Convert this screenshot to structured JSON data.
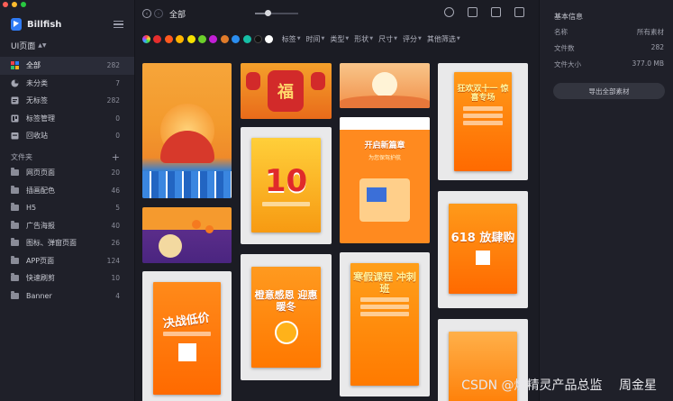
{
  "window": {
    "traffic_colors": [
      "#fe5f57",
      "#febc2e",
      "#28c840"
    ]
  },
  "app": {
    "name": "Billfish"
  },
  "library": {
    "name": "UI页面"
  },
  "nav": [
    {
      "label": "全部",
      "count": "282",
      "icon": "grid-icon",
      "active": true
    },
    {
      "label": "未分类",
      "count": "7",
      "icon": "uncategorized-icon",
      "active": false
    },
    {
      "label": "无标签",
      "count": "282",
      "icon": "untagged-icon",
      "active": false
    },
    {
      "label": "标签管理",
      "count": "0",
      "icon": "tag-manage-icon",
      "active": false
    },
    {
      "label": "回收站",
      "count": "0",
      "icon": "trash-icon",
      "active": false
    }
  ],
  "folders": {
    "title": "文件夹",
    "add_icon": "plus-icon",
    "items": [
      {
        "label": "网页页面",
        "count": "20"
      },
      {
        "label": "插画配色",
        "count": "46"
      },
      {
        "label": "H5",
        "count": "5"
      },
      {
        "label": "广告海报",
        "count": "40"
      },
      {
        "label": "图标、弹窗页面",
        "count": "26"
      },
      {
        "label": "APP页面",
        "count": "124"
      },
      {
        "label": "快速刷剪",
        "count": "10"
      },
      {
        "label": "Banner",
        "count": "4"
      }
    ]
  },
  "toolbar": {
    "breadcrumb": "全部",
    "zoom_level": 0.3,
    "icons": [
      "search-icon",
      "filter-icon",
      "layout-icon",
      "shirt-icon"
    ]
  },
  "filters": {
    "colors": [
      "multicolor",
      "#e52d2d",
      "#ff5a1f",
      "#ffb400",
      "#f5e100",
      "#6ccf2b",
      "#c21fd6",
      "#e07b2a",
      "#2b8ef0",
      "#16bfa6",
      "#111111",
      "#ffffff"
    ],
    "labels": [
      "标签",
      "时间",
      "类型",
      "形状",
      "尺寸",
      "评分",
      "其他筛选"
    ]
  },
  "cards": [
    {
      "text": "",
      "sub": ""
    },
    {
      "text": "福",
      "sub": ""
    },
    {
      "text": "",
      "sub": ""
    },
    {
      "text": "开启新篇章",
      "sub": "为您保驾护航"
    },
    {
      "text": "狂欢双十一 惊喜专场",
      "sub": ""
    },
    {
      "text": "10",
      "sub": ""
    },
    {
      "text": "",
      "sub": ""
    },
    {
      "text": "618 放肆购",
      "sub": ""
    },
    {
      "text": "决战低价",
      "sub": ""
    },
    {
      "text": "橙意感恩 迎惠暖冬",
      "sub": ""
    },
    {
      "text": "寒假课程 冲刺班",
      "sub": ""
    },
    {
      "text": "",
      "sub": ""
    }
  ],
  "panel": {
    "title": "基本信息",
    "rows": [
      {
        "key": "名称",
        "value": "所有素材"
      },
      {
        "key": "文件数",
        "value": "282"
      },
      {
        "key": "文件大小",
        "value": "377.0 MB"
      }
    ],
    "export_label": "导出全部素材"
  },
  "watermark": "CSDN @燃精灵产品总监　 周金星"
}
